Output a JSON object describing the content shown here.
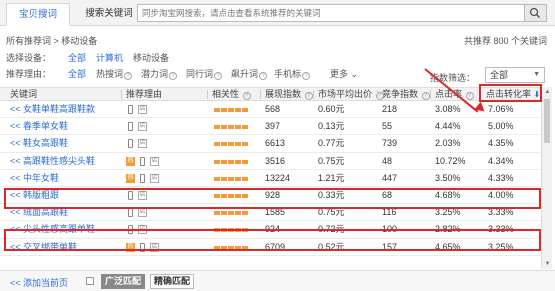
{
  "tabs": {
    "active": "宝贝搜词",
    "inactive": "搜索关键词"
  },
  "search": {
    "placeholder": "同步淘宝网搜索，请点击查看系统推荐的关键词"
  },
  "breadcrumb": "所有推荐词 > 移动设备",
  "total": "共推荐 800 个关键词",
  "device_filter": {
    "label": "选择设备：",
    "options": [
      "全部",
      "计算机",
      "移动设备"
    ]
  },
  "reason_filter": {
    "label": "推荐理由：",
    "options": [
      "全部",
      "热搜词",
      "潜力词",
      "同行词",
      "飙升词",
      "手机标"
    ],
    "more": "更多"
  },
  "metric_filter": {
    "label": "指数筛选：",
    "value": "全部"
  },
  "table": {
    "columns": [
      "关键词",
      "推荐理由",
      "相关性",
      "展现指数",
      "市场平均出价",
      "竞争指数",
      "点击率",
      "点击转化率"
    ],
    "rows": [
      {
        "keyword": "<< 女鞋单鞋高跟鞋款",
        "hot": false,
        "impressions": "568",
        "bid": "0.60元",
        "competition": "218",
        "ctr": "3.08%",
        "cvr": "7.06%"
      },
      {
        "keyword": "<< 春季单女鞋",
        "hot": false,
        "impressions": "397",
        "bid": "0.13元",
        "competition": "55",
        "ctr": "4.44%",
        "cvr": "5.00%"
      },
      {
        "keyword": "<< 鞋女高跟鞋",
        "hot": false,
        "impressions": "6613",
        "bid": "0.77元",
        "competition": "739",
        "ctr": "2.03%",
        "cvr": "4.35%"
      },
      {
        "keyword": "<< 高跟鞋性感尖头鞋",
        "hot": true,
        "impressions": "3516",
        "bid": "0.75元",
        "competition": "48",
        "ctr": "10.72%",
        "cvr": "4.34%"
      },
      {
        "keyword": "<< 中年女鞋",
        "hot": true,
        "impressions": "13224",
        "bid": "1.21元",
        "competition": "447",
        "ctr": "3.50%",
        "cvr": "4.33%"
      },
      {
        "keyword": "<< 韩版粗跟",
        "hot": false,
        "impressions": "928",
        "bid": "0.33元",
        "competition": "68",
        "ctr": "4.68%",
        "cvr": "4.00%"
      },
      {
        "keyword": "<< 绒面高跟鞋",
        "hot": false,
        "impressions": "1585",
        "bid": "0.75元",
        "competition": "116",
        "ctr": "3.25%",
        "cvr": "3.33%"
      },
      {
        "keyword": "<< 尖头性感高跟单鞋",
        "hot": false,
        "impressions": "924",
        "bid": "0.72元",
        "competition": "100",
        "ctr": "2.82%",
        "cvr": "3.33%"
      },
      {
        "keyword": "<< 交叉绑带单鞋",
        "hot": true,
        "impressions": "6709",
        "bid": "0.52元",
        "competition": "157",
        "ctr": "4.65%",
        "cvr": "3.25%"
      }
    ]
  },
  "footer": {
    "add_home": "<< 添加当前页",
    "broad": "广泛匹配",
    "exact": "精确匹配"
  },
  "icons": {
    "search": "search-icon",
    "phone": "phone-icon",
    "tao": "tao-icon",
    "hot": "hot-icon",
    "sort": "sort-down-icon"
  },
  "colors": {
    "accent": "#2d6ed1",
    "highlight": "#e0262a",
    "bar": "#f59a38"
  }
}
